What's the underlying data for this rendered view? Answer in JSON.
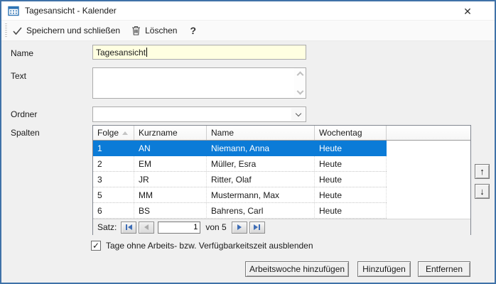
{
  "window": {
    "title": "Tagesansicht - Kalender",
    "close_glyph": "✕"
  },
  "toolbar": {
    "save_close_label": "Speichern und schließen",
    "delete_label": "Löschen",
    "help_label": "?"
  },
  "fields": {
    "name": {
      "label": "Name",
      "value": "Tagesansicht"
    },
    "text": {
      "label": "Text",
      "value": ""
    },
    "ordner": {
      "label": "Ordner",
      "value": ""
    },
    "spalten": {
      "label": "Spalten"
    }
  },
  "table": {
    "columns": [
      "Folge",
      "Kurzname",
      "Name",
      "Wochentag"
    ],
    "sort": {
      "column": "Folge",
      "direction": "asc"
    },
    "rows": [
      {
        "folge": "1",
        "kurzname": "AN",
        "name": "Niemann, Anna",
        "wochentag": "Heute",
        "selected": true
      },
      {
        "folge": "2",
        "kurzname": "EM",
        "name": "Müller, Esra",
        "wochentag": "Heute",
        "selected": false
      },
      {
        "folge": "3",
        "kurzname": "JR",
        "name": "Ritter, Olaf",
        "wochentag": "Heute",
        "selected": false
      },
      {
        "folge": "5",
        "kurzname": "MM",
        "name": "Mustermann, Max",
        "wochentag": "Heute",
        "selected": false
      },
      {
        "folge": "6",
        "kurzname": "BS",
        "name": "Bahrens, Carl",
        "wochentag": "Heute",
        "selected": false
      }
    ],
    "record_nav": {
      "label": "Satz:",
      "current": "1",
      "of": "von 5"
    }
  },
  "reorder": {
    "up_glyph": "↑",
    "down_glyph": "↓"
  },
  "options": {
    "hide_days": {
      "label": "Tage ohne Arbeits- bzw. Verfügbarkeitszeit ausblenden",
      "checked": true
    }
  },
  "actions": {
    "add_workweek": "Arbeitswoche hinzufügen",
    "add": "Hinzufügen",
    "remove": "Entfernen"
  },
  "icons": {
    "check_glyph": "✓"
  },
  "colors": {
    "selection": "#0b7bd7",
    "window_border": "#3f72a8",
    "field_highlight": "#ffffe1",
    "background": "#f0f0f0"
  }
}
